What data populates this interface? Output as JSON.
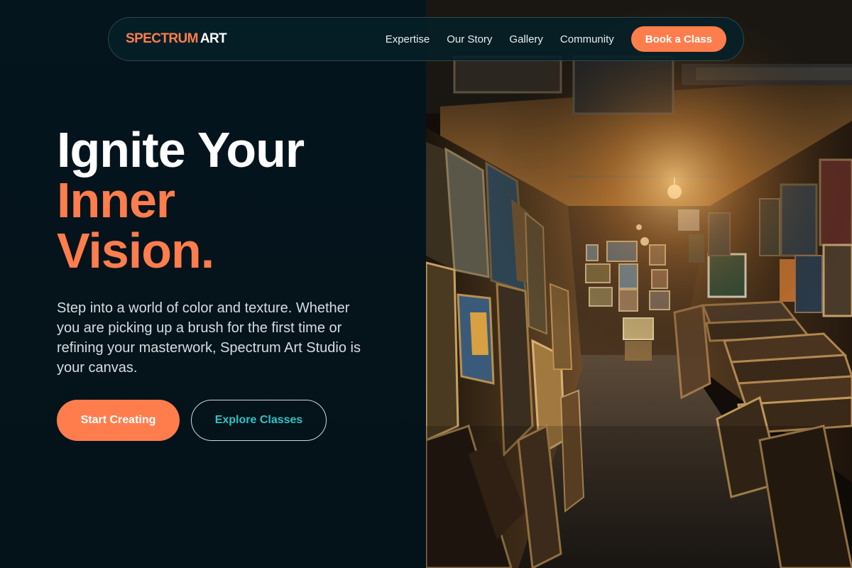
{
  "brand": {
    "logo_part1": "SPECTRUM",
    "logo_part2": "ART",
    "accent_color": "#ff7d4d",
    "teal_color": "#2ec4c4",
    "background_color": "#04151d"
  },
  "nav": {
    "links": [
      {
        "label": "Expertise"
      },
      {
        "label": "Our Story"
      },
      {
        "label": "Gallery"
      },
      {
        "label": "Community"
      }
    ],
    "cta_label": "Book a Class"
  },
  "hero": {
    "title_line1": "Ignite Your",
    "title_line2": "Inner",
    "title_line3": "Vision.",
    "description": "Step into a world of color and texture. Whether you are picking up a brush for the first time or refining your masterwork, Spectrum Art Studio is your canvas.",
    "primary_button": "Start Creating",
    "secondary_button": "Explore Classes"
  },
  "image": {
    "icon": "art-gallery-photo"
  }
}
